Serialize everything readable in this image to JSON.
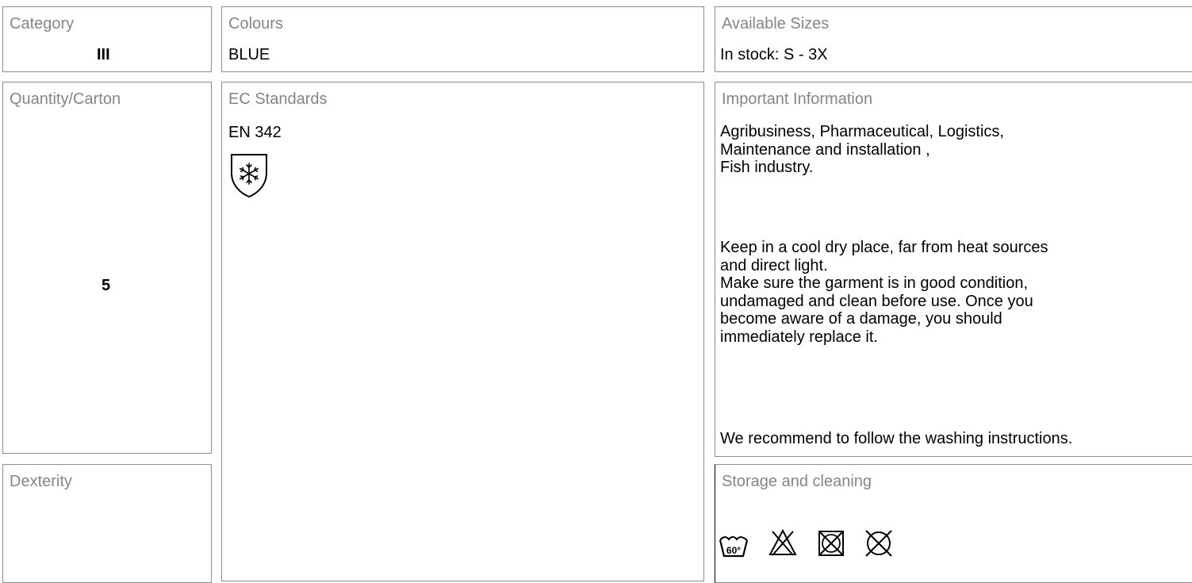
{
  "category": {
    "label": "Category",
    "value": "III"
  },
  "colours": {
    "label": "Colours",
    "value": "BLUE"
  },
  "sizes": {
    "label": "Available Sizes",
    "value": "In stock: S - 3X"
  },
  "quantity": {
    "label": "Quantity/Carton",
    "value": "5"
  },
  "standards": {
    "label": "EC Standards",
    "value": "EN 342",
    "pictogram": "cold-protection-shield-icon"
  },
  "info": {
    "label": "Important Information",
    "usage": "Agribusiness, Pharmaceutical, Logistics,\nMaintenance and installation ,\nFish industry.",
    "storage": "Keep in a cool dry place, far from heat sources\nand direct light.\nMake sure the garment is in good condition,\nundamaged and clean before use. Once you\nbecome aware of a damage, you should\nimmediately replace it.",
    "washing": "We recommend to follow the washing instructions."
  },
  "dexterity": {
    "label": "Dexterity"
  },
  "storage_cleaning": {
    "label": "Storage and cleaning",
    "wash_temp": "60°",
    "icons": [
      "wash-60-icon",
      "do-not-bleach-icon",
      "do-not-tumble-dry-icon",
      "do-not-dry-clean-icon"
    ]
  }
}
